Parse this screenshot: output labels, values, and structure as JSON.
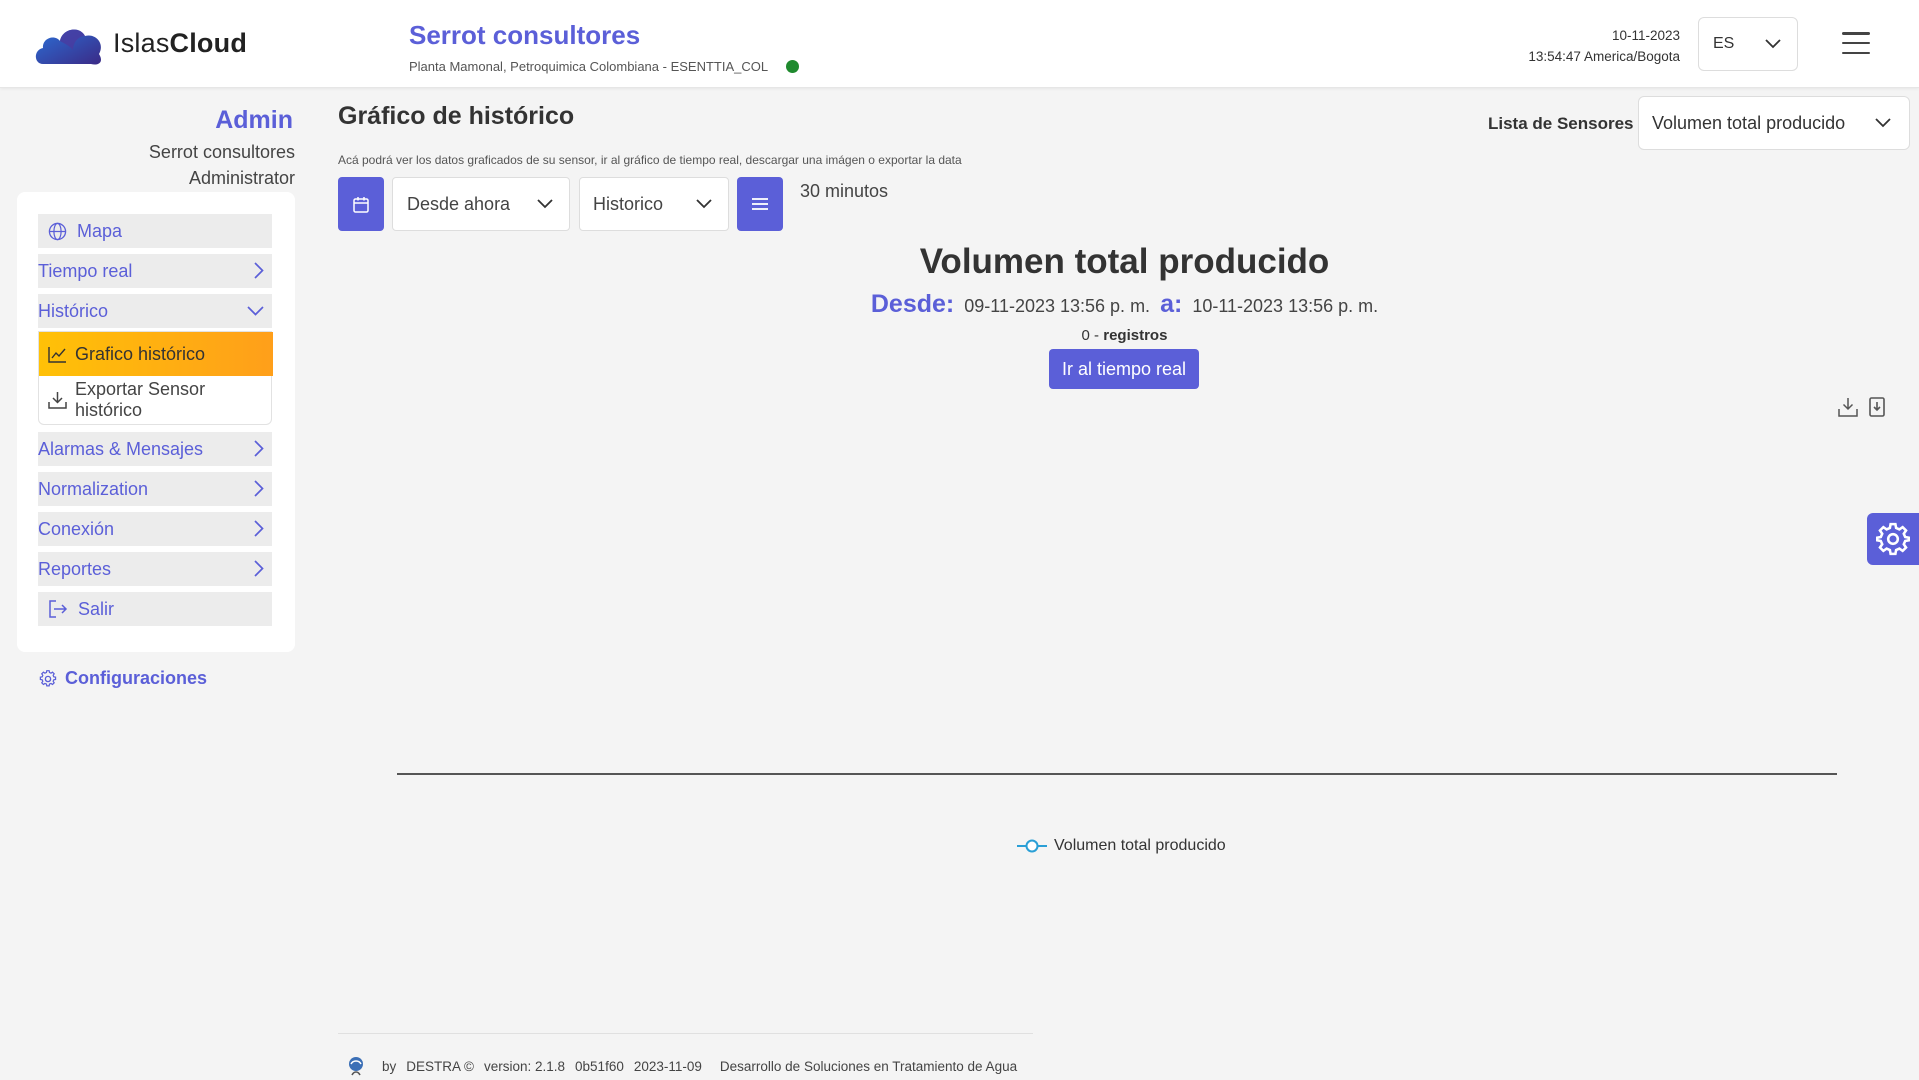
{
  "header": {
    "logo_text_light": "Islas",
    "logo_text_bold": "Cloud",
    "company_name": "Serrot consultores",
    "company_subtitle": "Planta Mamonal, Petroquimica Colombiana - ESENTTIA_COL",
    "status_color": "#1f8a2e",
    "date": "10-11-2023",
    "time": "13:54:47 America/Bogota",
    "language": "ES"
  },
  "sidebar": {
    "role_title": "Admin",
    "organization": "Serrot consultores",
    "role": "Administrator",
    "items": [
      {
        "label": "Mapa",
        "icon": "globe-icon"
      },
      {
        "label": "Tiempo real",
        "icon": "chevron-right-icon"
      },
      {
        "label": "Histórico",
        "icon": "chevron-down-icon"
      },
      {
        "label": "Alarmas & Mensajes",
        "icon": "chevron-right-icon"
      },
      {
        "label": "Normalization",
        "icon": "chevron-right-icon"
      },
      {
        "label": "Conexión",
        "icon": "chevron-right-icon"
      },
      {
        "label": "Reportes",
        "icon": "chevron-right-icon"
      },
      {
        "label": "Salir",
        "icon": "logout-icon"
      }
    ],
    "submenu": {
      "active": {
        "label": "Grafico histórico",
        "icon": "chart-line-icon"
      },
      "item": {
        "label": "Exportar Sensor histórico",
        "icon": "download-icon"
      }
    },
    "config_label": "Configuraciones"
  },
  "main": {
    "title": "Gráfico de histórico",
    "description": "Acá podrá ver los datos graficados de su sensor, ir al gráfico de tiempo real, descargar una imágen o exportar la data",
    "sensor_list_label": "Lista de Sensores",
    "sensor_selected": "Volumen total producido",
    "range_select": "Desde ahora",
    "mode_select": "Historico",
    "interval": "30 minutos",
    "chart_title": "Volumen total producido",
    "from_label": "Desde:",
    "from_value": "09-11-2023 13:56 p. m.",
    "to_label": "a:",
    "to_value": "10-11-2023 13:56 p. m.",
    "records_count": "0",
    "records_sep": " - ",
    "records_label": "registros",
    "realtime_button": "Ir al tiempo real",
    "legend_label": "Volumen total producido",
    "accent_color": "#5b5fd8",
    "series_color": "#2a9fd6"
  },
  "footer": {
    "by": "by",
    "brand": "DESTRA ©",
    "version": "version: 2.1.8",
    "commit": "0b51f60",
    "date": "2023-11-09",
    "tagline": "Desarrollo de Soluciones en Tratamiento de Agua"
  }
}
